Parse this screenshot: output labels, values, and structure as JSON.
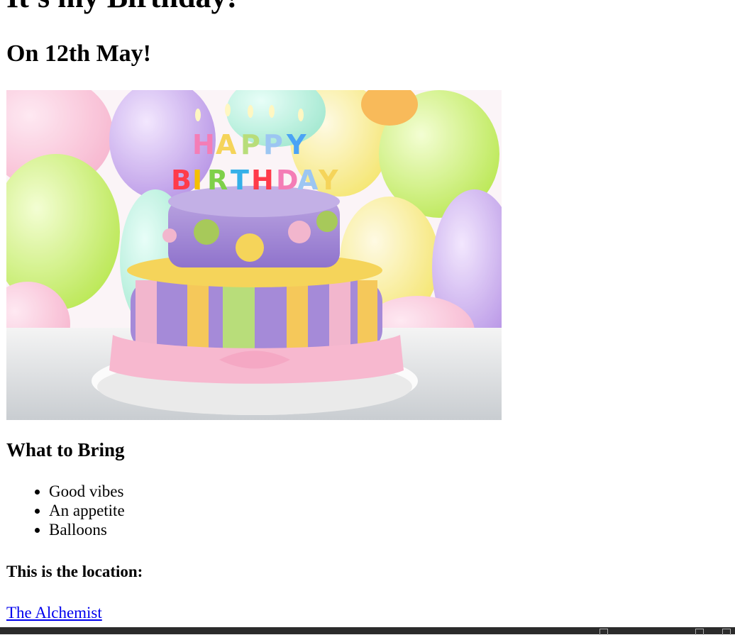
{
  "heading": {
    "title": "It's my Birthday!",
    "subtitle": "On 12th May!"
  },
  "hero_image": {
    "name": "birthday-cake-photo",
    "candle_text_top": "HAPPY",
    "candle_text_bottom": "BIRTHDAY"
  },
  "bring": {
    "title": "What to Bring",
    "items": [
      "Good vibes",
      "An appetite",
      "Balloons"
    ]
  },
  "location": {
    "label": "This is the location:",
    "link_text": "The Alchemist"
  },
  "colors": {
    "link": "#0000ee",
    "taskbar": "#2b2b2b"
  }
}
